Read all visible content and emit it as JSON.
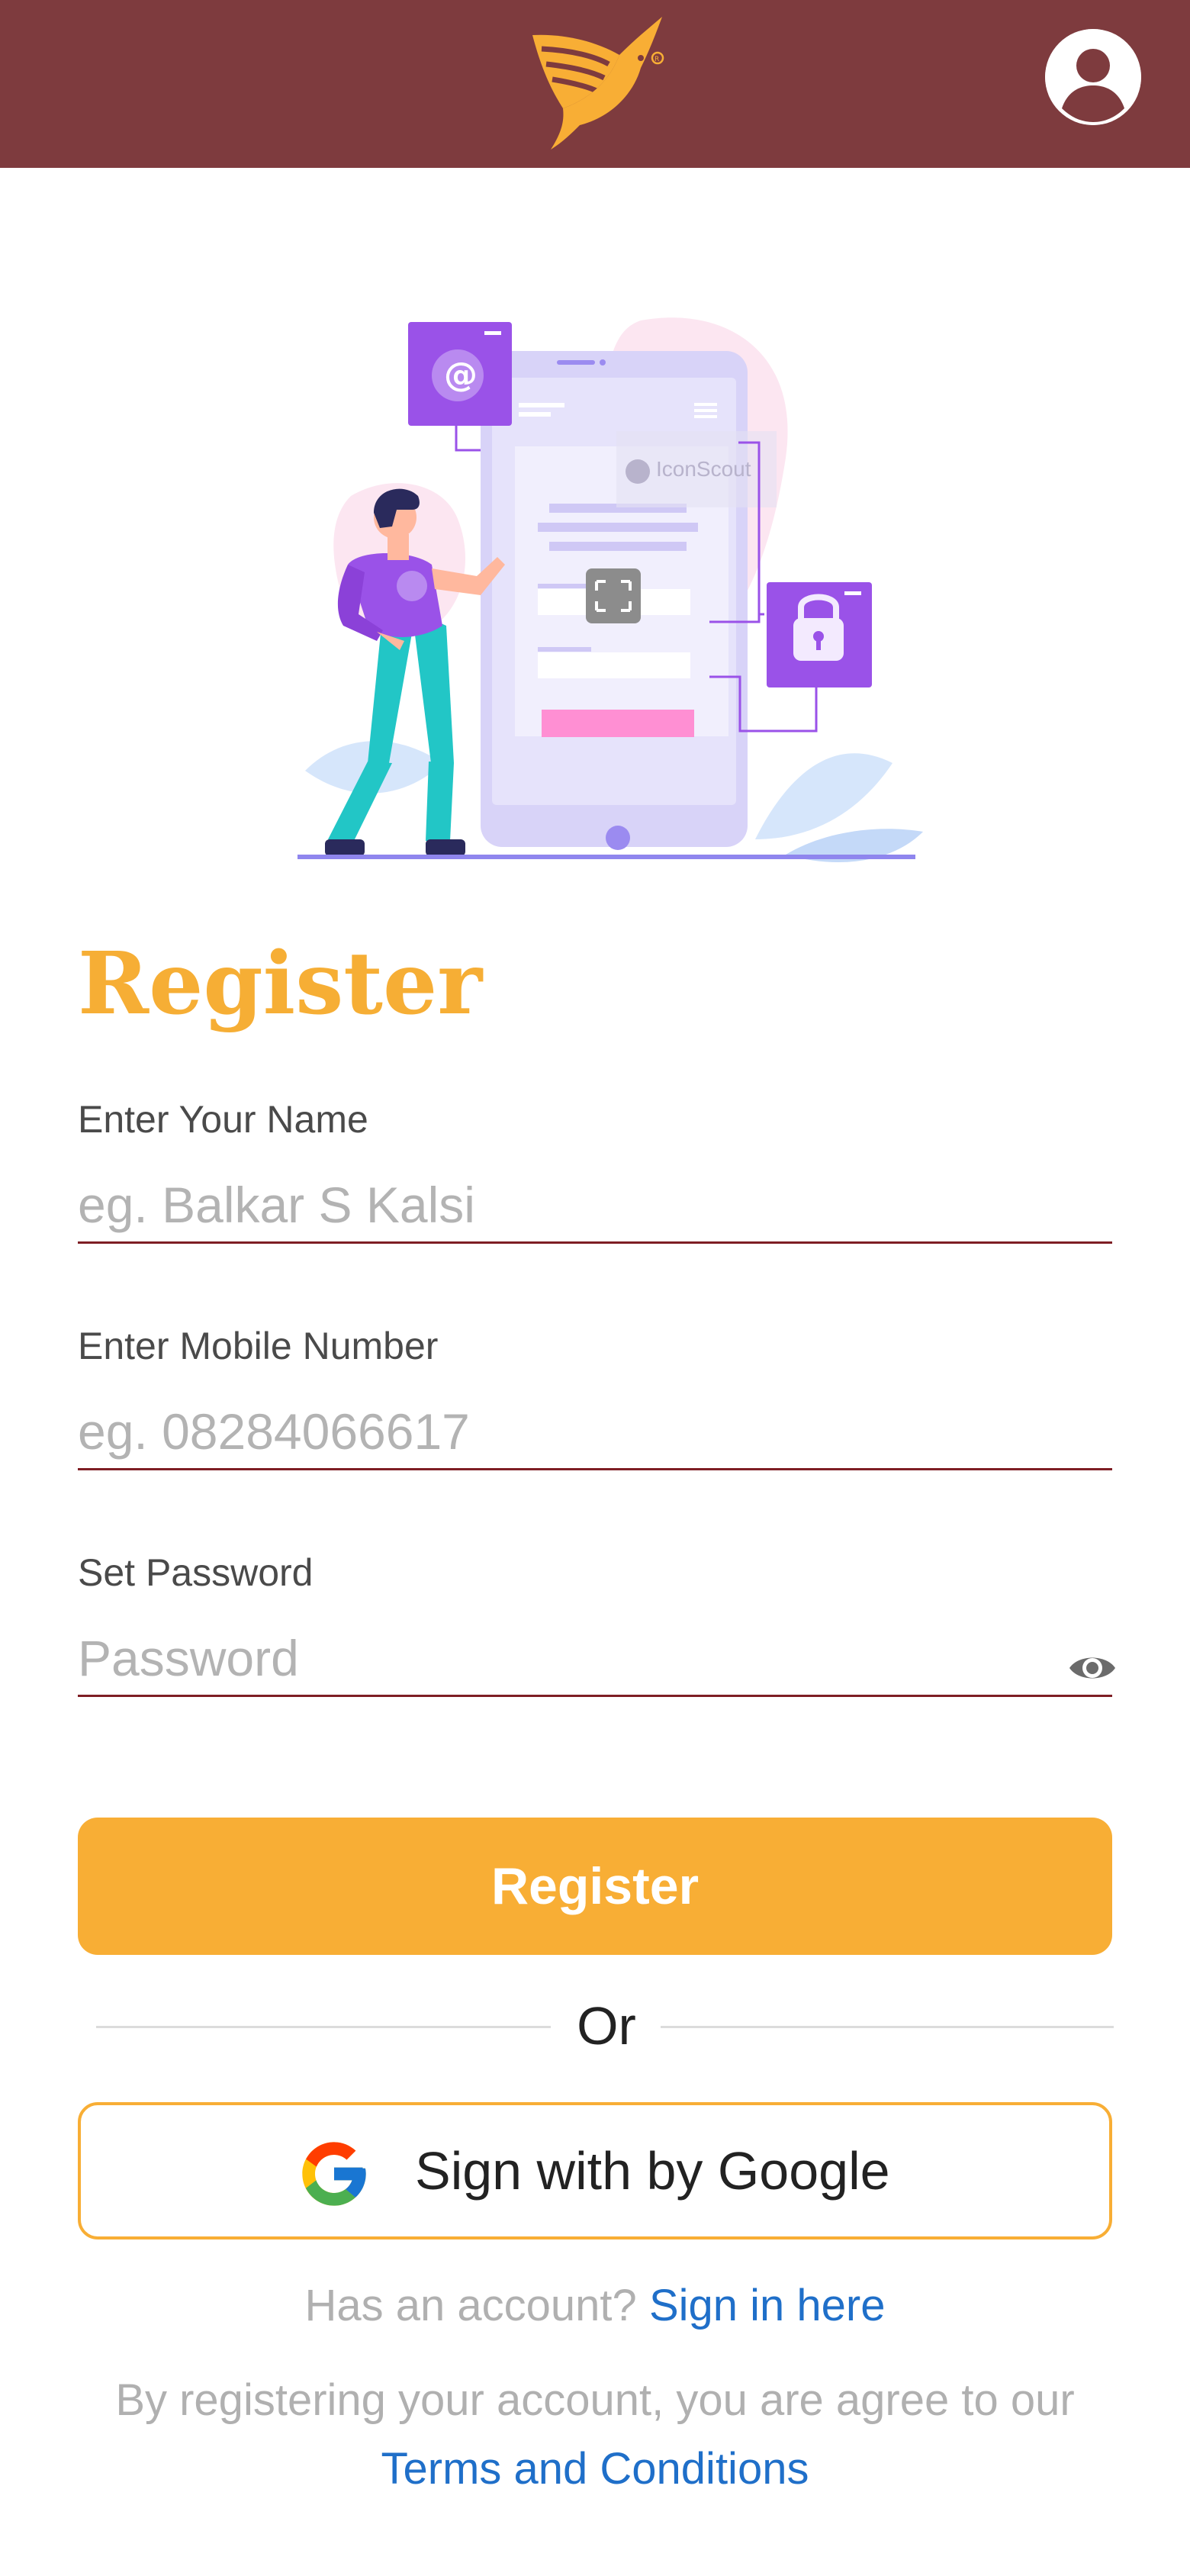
{
  "header": {
    "logo_icon": "bird-logo-icon",
    "profile_icon": "user-profile-icon"
  },
  "hero": {
    "illustration": "register-illustration",
    "watermark": "IconScout"
  },
  "form": {
    "title": "Register",
    "name": {
      "label": "Enter Your Name",
      "placeholder": "eg. Balkar S Kalsi",
      "value": ""
    },
    "mobile": {
      "label": "Enter Mobile Number",
      "placeholder": "eg. 08284066617",
      "value": ""
    },
    "password": {
      "label": "Set Password",
      "placeholder": "Password",
      "value": "",
      "toggle_icon": "eye-icon"
    },
    "submit_label": "Register"
  },
  "divider": {
    "label": "Or"
  },
  "google": {
    "label": "Sign with by Google",
    "icon": "google-icon"
  },
  "footer": {
    "account_prompt": "Has an account?",
    "sign_in_link": "Sign in here",
    "terms_text": "By registering your account, you are agree to our",
    "terms_link": "Terms and Conditions"
  },
  "colors": {
    "header_bg": "#7e3b3e",
    "accent": "#f8ae35",
    "field_underline": "#7e1e24",
    "link": "#1f6fc9",
    "muted_text": "#b0b0b0"
  }
}
